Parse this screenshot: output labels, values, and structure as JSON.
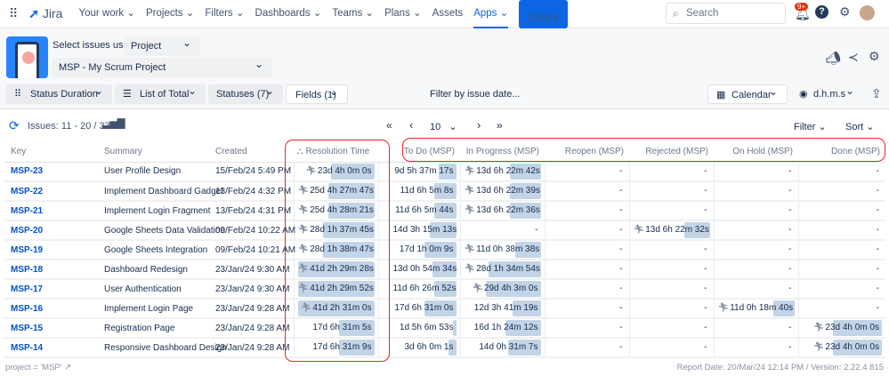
{
  "nav": {
    "brand": "Jira",
    "items": [
      "Your work ⌄",
      "Projects ⌄",
      "Filters ⌄",
      "Dashboards ⌄",
      "Teams ⌄",
      "Plans ⌄",
      "Assets"
    ],
    "active": "Apps ⌄",
    "create": "Create",
    "search_placeholder": "Search",
    "notif_badge": "9+"
  },
  "panel": {
    "select_label": "Select issues using",
    "select_value": "Project",
    "project": "MSP - My Scrum Project",
    "status_duration": "Status Duration",
    "list_of_total": "List of Total",
    "statuses": "Statuses (7)",
    "fields": "Fields (1)",
    "filter_date": "Filter by issue date...",
    "calendar": "Calendar",
    "format": "d.h.m.s"
  },
  "toolbar": {
    "issues": "Issues: 11 - 20 / 33",
    "first": "«",
    "prev": "‹",
    "page_size": "10",
    "next": "›",
    "last": "»",
    "filter": "Filter",
    "sort": "Sort"
  },
  "columns": [
    "Key",
    "Summary",
    "Created",
    "Resolution Time",
    "To Do (MSP)",
    "In Progress (MSP)",
    "Reopen (MSP)",
    "Rejected (MSP)",
    "On Hold (MSP)",
    "Done (MSP)"
  ],
  "accent": "#0c66e4",
  "bar_color": "#c3d4e6",
  "highlight": "#e5252a",
  "rows": [
    {
      "key": "MSP-23",
      "summary": "User Profile Design",
      "created": "15/Feb/24 5:49 PM",
      "cells": [
        {
          "v": "23d 4h 0m 0s",
          "f": 0.56,
          "r": 1
        },
        {
          "v": "9d 5h 37m 17s",
          "f": 0.28
        },
        {
          "v": "13d 6h 22m 42s",
          "f": 0.4,
          "r": 1
        },
        {
          "v": "-"
        },
        {
          "v": "-"
        },
        {
          "v": "-"
        },
        {
          "v": "-"
        }
      ]
    },
    {
      "key": "MSP-22",
      "summary": "Implement Dashboard Gadget",
      "created": "13/Feb/24 4:32 PM",
      "cells": [
        {
          "v": "25d 4h 27m 47s",
          "f": 0.6,
          "r": 1
        },
        {
          "v": "11d 6h 5m 8s",
          "f": 0.35
        },
        {
          "v": "13d 6h 22m 39s",
          "f": 0.4,
          "r": 1
        },
        {
          "v": "-"
        },
        {
          "v": "-"
        },
        {
          "v": "-"
        },
        {
          "v": "-"
        }
      ]
    },
    {
      "key": "MSP-21",
      "summary": "Implement Login Fragment",
      "created": "13/Feb/24 4:31 PM",
      "cells": [
        {
          "v": "25d 4h 28m 21s",
          "f": 0.6,
          "r": 1
        },
        {
          "v": "11d 6h 5m 44s",
          "f": 0.35
        },
        {
          "v": "13d 6h 22m 36s",
          "f": 0.4,
          "r": 1
        },
        {
          "v": "-"
        },
        {
          "v": "-"
        },
        {
          "v": "-"
        },
        {
          "v": "-"
        }
      ]
    },
    {
      "key": "MSP-20",
      "summary": "Google Sheets Data Validation",
      "created": "09/Feb/24 10:22 AM",
      "cells": [
        {
          "v": "28d 1h 37m 45s",
          "f": 0.67,
          "r": 1
        },
        {
          "v": "14d 3h 15m 13s",
          "f": 0.42
        },
        {
          "v": "-"
        },
        {
          "v": "-"
        },
        {
          "v": "13d 6h 22m 32s",
          "f": 0.33,
          "r": 1
        },
        {
          "v": "-"
        },
        {
          "v": "-"
        }
      ]
    },
    {
      "key": "MSP-19",
      "summary": "Google Sheets Integration",
      "created": "09/Feb/24 10:21 AM",
      "cells": [
        {
          "v": "28d 1h 38m 47s",
          "f": 0.67,
          "r": 1
        },
        {
          "v": "17d 1h 0m 9s",
          "f": 0.5
        },
        {
          "v": "11d 0h 38m 38s",
          "f": 0.33,
          "r": 1
        },
        {
          "v": "-"
        },
        {
          "v": "-"
        },
        {
          "v": "-"
        },
        {
          "v": "-"
        }
      ]
    },
    {
      "key": "MSP-18",
      "summary": "Dashboard Redesign",
      "created": "23/Jan/24 9:30 AM",
      "cells": [
        {
          "v": "41d 2h 29m 28s",
          "f": 1,
          "r": 1
        },
        {
          "v": "13d 0h 54m 34s",
          "f": 0.38
        },
        {
          "v": "28d 1h 34m 54s",
          "f": 0.68,
          "r": 1
        },
        {
          "v": "-"
        },
        {
          "v": "-"
        },
        {
          "v": "-"
        },
        {
          "v": "-"
        }
      ]
    },
    {
      "key": "MSP-17",
      "summary": "User Authentication",
      "created": "23/Jan/24 9:30 AM",
      "cells": [
        {
          "v": "41d 2h 29m 52s",
          "f": 1,
          "r": 1
        },
        {
          "v": "11d 6h 26m 52s",
          "f": 0.35
        },
        {
          "v": "29d 4h 3m 0s",
          "f": 0.71,
          "r": 1
        },
        {
          "v": "-"
        },
        {
          "v": "-"
        },
        {
          "v": "-"
        },
        {
          "v": "-"
        }
      ]
    },
    {
      "key": "MSP-16",
      "summary": "Implement Login Page",
      "created": "23/Jan/24 9:28 AM",
      "cells": [
        {
          "v": "41d 2h 31m 0s",
          "f": 1,
          "r": 1
        },
        {
          "v": "17d 6h 31m 0s",
          "f": 0.5
        },
        {
          "v": "12d 3h 41m 19s",
          "f": 0.37
        },
        {
          "v": "-"
        },
        {
          "v": "-"
        },
        {
          "v": "11d 0h 18m 40s",
          "f": 0.27,
          "r": 1
        },
        {
          "v": "-"
        }
      ]
    },
    {
      "key": "MSP-15",
      "summary": "Registration Page",
      "created": "23/Jan/24 9:28 AM",
      "cells": [
        {
          "v": "17d 6h 31m 5s",
          "f": 0.46
        },
        {
          "v": "1d 5h 6m 53s",
          "f": 0.05
        },
        {
          "v": "16d 1h 24m 12s",
          "f": 0.46
        },
        {
          "v": "-"
        },
        {
          "v": "-"
        },
        {
          "v": "-"
        },
        {
          "v": "23d 4h 0m 0s",
          "f": 0.62,
          "r": 1
        }
      ]
    },
    {
      "key": "MSP-14",
      "summary": "Responsive Dashboard Design",
      "created": "23/Jan/24 9:28 AM",
      "cells": [
        {
          "v": "17d 6h 31m 9s",
          "f": 0.46
        },
        {
          "v": "3d 6h 0m 1s",
          "f": 0.12
        },
        {
          "v": "14d 0h 31m 7s",
          "f": 0.42
        },
        {
          "v": "-"
        },
        {
          "v": "-"
        },
        {
          "v": "-"
        },
        {
          "v": "23d 4h 0m 0s",
          "f": 0.62,
          "r": 1
        }
      ]
    }
  ],
  "footer": {
    "jql": "project = 'MSP'",
    "report": "Report Date: 20/Mar/24 12:14 PM / Version: 2.22.4.815"
  }
}
